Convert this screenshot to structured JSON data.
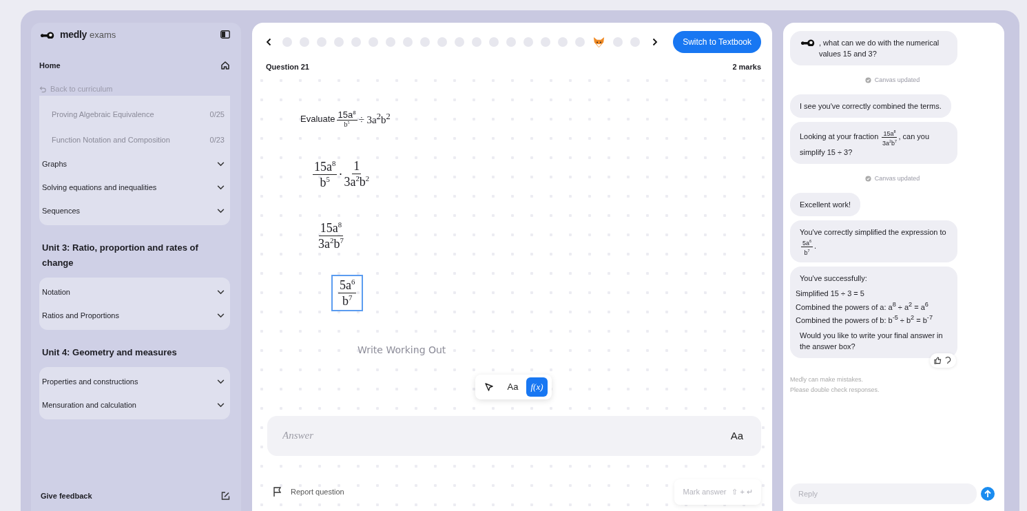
{
  "sidebar": {
    "brand": {
      "name": "medly",
      "suffix": "exams"
    },
    "home": {
      "label": "Home"
    },
    "back": {
      "label": "Back to curriculum"
    },
    "sections": [
      {
        "kind": "topics",
        "items": [
          {
            "kind": "subtopic",
            "label": "Proving Algebraic Equivalence",
            "count": "0/25"
          },
          {
            "kind": "subtopic",
            "label": "Function Notation and Composition",
            "count": "0/23"
          },
          {
            "kind": "topic",
            "label": "Graphs",
            "expanded": false
          },
          {
            "kind": "topic",
            "label": "Solving equations and inequalities",
            "expanded": false
          },
          {
            "kind": "topic",
            "label": "Sequences",
            "expanded": false
          }
        ]
      },
      {
        "kind": "unit",
        "title": "Unit 3: Ratio, proportion and rates of change",
        "items": [
          {
            "kind": "topic",
            "label": "Notation",
            "expanded": false
          },
          {
            "kind": "topic",
            "label": "Ratios and Proportions",
            "expanded": false
          }
        ]
      },
      {
        "kind": "unit",
        "title": "Unit 4: Geometry and measures",
        "items": [
          {
            "kind": "topic",
            "label": "Properties and constructions",
            "expanded": false
          },
          {
            "kind": "topic",
            "label": "Mensuration and calculation",
            "expanded": false
          }
        ]
      }
    ],
    "feedback": {
      "label": "Give feedback"
    }
  },
  "question": {
    "progress": [
      {
        "kind": "dot"
      },
      {
        "kind": "dot"
      },
      {
        "kind": "dot"
      },
      {
        "kind": "dot"
      },
      {
        "kind": "dot"
      },
      {
        "kind": "dot"
      },
      {
        "kind": "dot"
      },
      {
        "kind": "dot"
      },
      {
        "kind": "dot"
      },
      {
        "kind": "dot"
      },
      {
        "kind": "dot"
      },
      {
        "kind": "dot"
      },
      {
        "kind": "dot"
      },
      {
        "kind": "dot"
      },
      {
        "kind": "dot"
      },
      {
        "kind": "dot"
      },
      {
        "kind": "dot"
      },
      {
        "kind": "dot"
      },
      {
        "kind": "fox"
      },
      {
        "kind": "dot"
      },
      {
        "kind": "dot"
      }
    ],
    "switch_button": "Switch to Textbook",
    "title": "Question 21",
    "marks": "2 marks",
    "prompt": [
      {
        "text": "Evaluate "
      },
      {
        "num": "15a$^{8}$",
        "den": "b$^{5}$"
      },
      {
        "text": " ÷ 3a$^{2}$b$^{2}$"
      }
    ],
    "working": [
      {
        "boxed": false,
        "parts": [
          {
            "num": "15a$^{8}$",
            "den": "b$^{5}$"
          },
          {
            "text": " · "
          },
          {
            "num": "1",
            "den": "3a$^{2}$b$^{2}$"
          }
        ]
      },
      {
        "boxed": false,
        "parts": [
          {
            "num": "15a$^{8}$",
            "den": "3a$^{2}$b$^{7}$"
          }
        ]
      },
      {
        "boxed": true,
        "parts": [
          {
            "num": "5a$^{6}$",
            "den": "b$^{7}$"
          }
        ]
      }
    ],
    "working_placeholder": "Write Working Out",
    "tools": [
      {
        "kind": "pointer",
        "selected": false
      },
      {
        "kind": "text",
        "label": "Aa",
        "selected": false
      },
      {
        "kind": "math",
        "label": "f(x)",
        "selected": true
      }
    ],
    "answer": {
      "placeholder": "Answer",
      "mode": "Aa"
    },
    "report": "Report question",
    "mark_button": {
      "label": "Mark answer",
      "shortcut": "⇧ + ↵",
      "disabled": true
    }
  },
  "chat": {
    "messages": [
      {
        "kind": "bot",
        "logo": true,
        "paragraphs": [
          {
            "kind": "text",
            "parts": [
              {
                "text": ", what can we do with the numerical values 15 and 3?"
              }
            ]
          }
        ]
      },
      {
        "kind": "status",
        "text": "Canvas updated"
      },
      {
        "kind": "bot",
        "paragraphs": [
          {
            "kind": "text",
            "parts": [
              {
                "text": "I see you've correctly combined the terms."
              }
            ]
          }
        ]
      },
      {
        "kind": "bot",
        "paragraphs": [
          {
            "kind": "text",
            "parts": [
              {
                "text": "Looking at your fraction "
              },
              {
                "num": "15a$^{8}$",
                "den": "3a$^{2}$b$^{7}$"
              },
              {
                "text": ", can you simplify 15 ÷ 3?"
              }
            ]
          }
        ]
      },
      {
        "kind": "status",
        "text": "Canvas updated"
      },
      {
        "kind": "bot",
        "paragraphs": [
          {
            "kind": "text",
            "parts": [
              {
                "text": "Excellent work!"
              }
            ]
          }
        ]
      },
      {
        "kind": "bot",
        "paragraphs": [
          {
            "kind": "text",
            "parts": [
              {
                "text": "You've correctly simplified the expression to "
              },
              {
                "num": "5a$^{6}$",
                "den": "b$^{7}$"
              },
              {
                "text": "."
              }
            ]
          }
        ]
      },
      {
        "kind": "bot",
        "feedback": true,
        "paragraphs": [
          {
            "kind": "text",
            "parts": [
              {
                "text": "You've successfully:"
              }
            ]
          },
          {
            "kind": "list",
            "parts": [
              {
                "text": "Simplified 15 ÷ 3 = 5"
              }
            ]
          },
          {
            "kind": "list",
            "parts": [
              {
                "text": "Combined the powers of a: a$^{8}$ ÷ a$^{2}$ = a$^{6}$"
              }
            ]
          },
          {
            "kind": "list",
            "parts": [
              {
                "text": "Combined the powers of b: b$^{-5}$ ÷ b$^{2}$ = b$^{-7}$"
              }
            ]
          },
          {
            "kind": "text",
            "parts": [
              {
                "text": "Would you like to write your final answer in the answer box?"
              }
            ]
          }
        ]
      }
    ],
    "disclaimer": [
      "Medly can make mistakes.",
      "Please double check responses."
    ],
    "reply_placeholder": "Reply"
  }
}
